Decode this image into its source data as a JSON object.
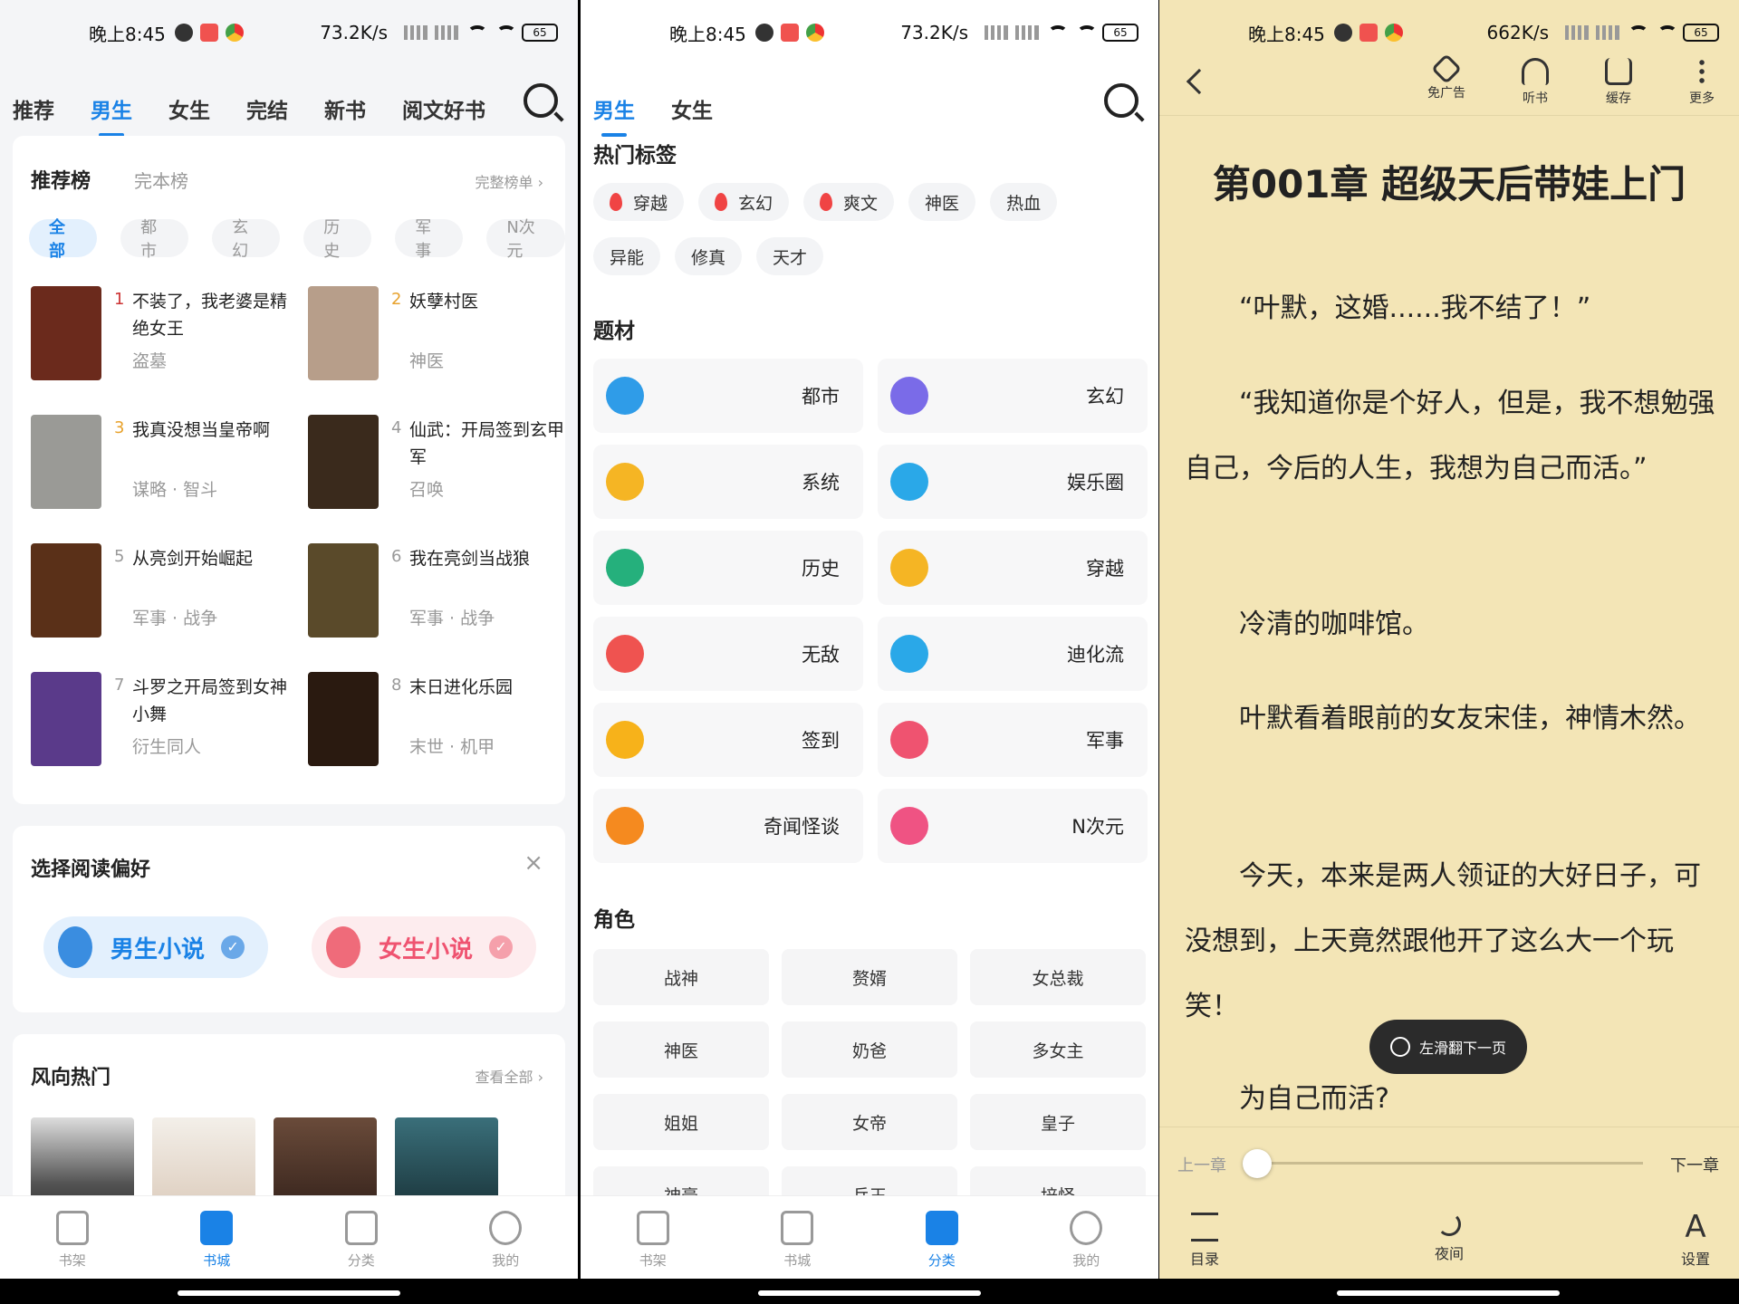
{
  "status": {
    "time": "晚上8:45",
    "speed_left": "73.2K/s",
    "speed_right": "662K/s",
    "battery": "65"
  },
  "p1": {
    "tabs": [
      "推荐",
      "男生",
      "女生",
      "完结",
      "新书",
      "阅文好书"
    ],
    "rank": {
      "title": "推荐榜",
      "sub": "完本榜",
      "more": "完整榜单 ›",
      "chips": [
        "全部",
        "都市",
        "玄幻",
        "历史",
        "军事",
        "N次元"
      ],
      "items": [
        {
          "num": "1",
          "title": "不装了，我老婆是精绝女王",
          "tags": "盗墓",
          "color": "#c33"
        },
        {
          "num": "2",
          "title": "妖孽村医",
          "tags": "神医",
          "color": "#e8a22c"
        },
        {
          "num": "3",
          "title": "我真没想当皇帝啊",
          "tags": "谋略 · 智斗",
          "color": "#e8a22c"
        },
        {
          "num": "4",
          "title": "仙武：开局签到玄甲军",
          "tags": "召唤",
          "color": "#999"
        },
        {
          "num": "5",
          "title": "从亮剑开始崛起",
          "tags": "军事 · 战争",
          "color": "#999"
        },
        {
          "num": "6",
          "title": "我在亮剑当战狼",
          "tags": "军事 · 战争",
          "color": "#999"
        },
        {
          "num": "7",
          "title": "斗罗之开局签到女神小舞",
          "tags": "衍生同人",
          "color": "#999"
        },
        {
          "num": "8",
          "title": "末日进化乐园",
          "tags": "末世 · 机甲",
          "color": "#999"
        }
      ]
    },
    "pref": {
      "title": "选择阅读偏好",
      "close": "×",
      "male": "男生小说",
      "female": "女生小说"
    },
    "trend": {
      "title": "风向热门",
      "more": "查看全部 ›"
    }
  },
  "p2": {
    "tabs": [
      "男生",
      "女生"
    ],
    "hot_title": "热门标签",
    "hot_tags": [
      {
        "label": "穿越",
        "hot": true
      },
      {
        "label": "玄幻",
        "hot": true
      },
      {
        "label": "爽文",
        "hot": true
      },
      {
        "label": "神医",
        "hot": false
      },
      {
        "label": "热血",
        "hot": false
      },
      {
        "label": "异能",
        "hot": false
      },
      {
        "label": "修真",
        "hot": false
      },
      {
        "label": "天才",
        "hot": false
      }
    ],
    "genre_title": "题材",
    "genres": [
      {
        "label": "都市",
        "color": "#2f9ce8"
      },
      {
        "label": "玄幻",
        "color": "#7a6be8"
      },
      {
        "label": "系统",
        "color": "#f5b524"
      },
      {
        "label": "娱乐圈",
        "color": "#2aa8e8"
      },
      {
        "label": "历史",
        "color": "#25b07c"
      },
      {
        "label": "穿越",
        "color": "#f5b524"
      },
      {
        "label": "无敌",
        "color": "#ef5350"
      },
      {
        "label": "迪化流",
        "color": "#2aa8e8"
      },
      {
        "label": "签到",
        "color": "#f7b21a"
      },
      {
        "label": "军事",
        "color": "#ef5370"
      },
      {
        "label": "奇闻怪谈",
        "color": "#f58a1f"
      },
      {
        "label": "N次元",
        "color": "#ef5383"
      }
    ],
    "role_title": "角色",
    "roles": [
      "战神",
      "赘婿",
      "女总裁",
      "神医",
      "奶爸",
      "多女主",
      "姐姐",
      "女帝",
      "皇子",
      "神豪",
      "兵王",
      "培怪"
    ]
  },
  "nav": {
    "items": [
      "书架",
      "书城",
      "分类",
      "我的"
    ]
  },
  "p3": {
    "toolbar": [
      "免广告",
      "听书",
      "缓存",
      "更多"
    ],
    "chapter": "第001章 超级天后带娃上门",
    "paras": [
      "“叶默，这婚......我不结了！”",
      "“我知道你是个好人，但是，我不想勉强自己，今后的人生，我想为自己而活。”",
      "冷清的咖啡馆。",
      "叶默看着眼前的女友宋佳，神情木然。",
      "今天，本来是两人领证的大好日子，可没想到，上天竟然跟他开了这么大一个玩笑！",
      "为自己而活?"
    ],
    "toast": "左滑翻下一页",
    "prev": "上一章",
    "next": "下一章",
    "progress": 0.0,
    "bottom": [
      "目录",
      "夜间",
      "设置"
    ]
  }
}
